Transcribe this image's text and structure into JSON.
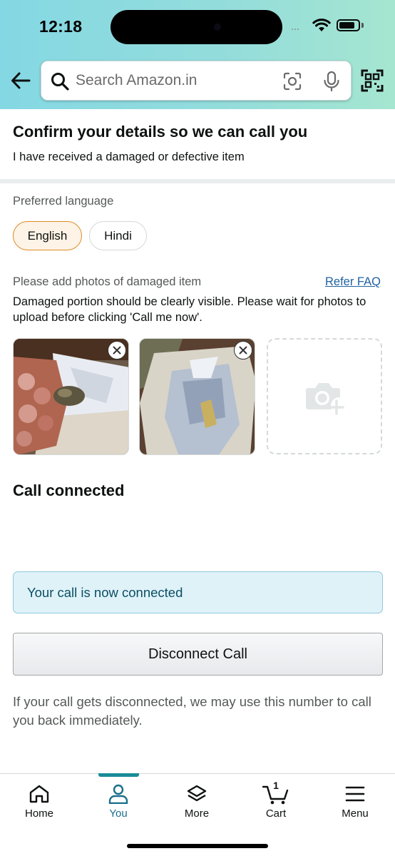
{
  "status_bar": {
    "time": "12:18"
  },
  "search": {
    "placeholder": "Search Amazon.in"
  },
  "page": {
    "title": "Confirm your details so we can call you",
    "subtitle": "I have received a damaged or defective item"
  },
  "language": {
    "label": "Preferred language",
    "options": [
      "English",
      "Hindi"
    ],
    "selected": "English"
  },
  "photos": {
    "label": "Please add photos of damaged item",
    "faq_link": "Refer FAQ",
    "note": "Damaged portion should be clearly visible. Please wait for photos to upload before clicking 'Call me now'."
  },
  "call": {
    "heading": "Call connected",
    "alert": "Your call is now connected",
    "disconnect_label": "Disconnect Call",
    "callback_note": "If your call gets disconnected, we may use this number to call you back immediately."
  },
  "bottom_nav": {
    "items": [
      {
        "label": "Home",
        "icon": "home-icon"
      },
      {
        "label": "You",
        "icon": "person-icon",
        "active": true
      },
      {
        "label": "More",
        "icon": "layers-icon"
      },
      {
        "label": "Cart",
        "icon": "cart-icon",
        "count": "1"
      },
      {
        "label": "Menu",
        "icon": "menu-icon"
      }
    ]
  },
  "colors": {
    "accent_teal": "#1a8b98",
    "selected_pill_border": "#e08b29",
    "link": "#2162a1",
    "alert_bg": "#dff2f8"
  }
}
